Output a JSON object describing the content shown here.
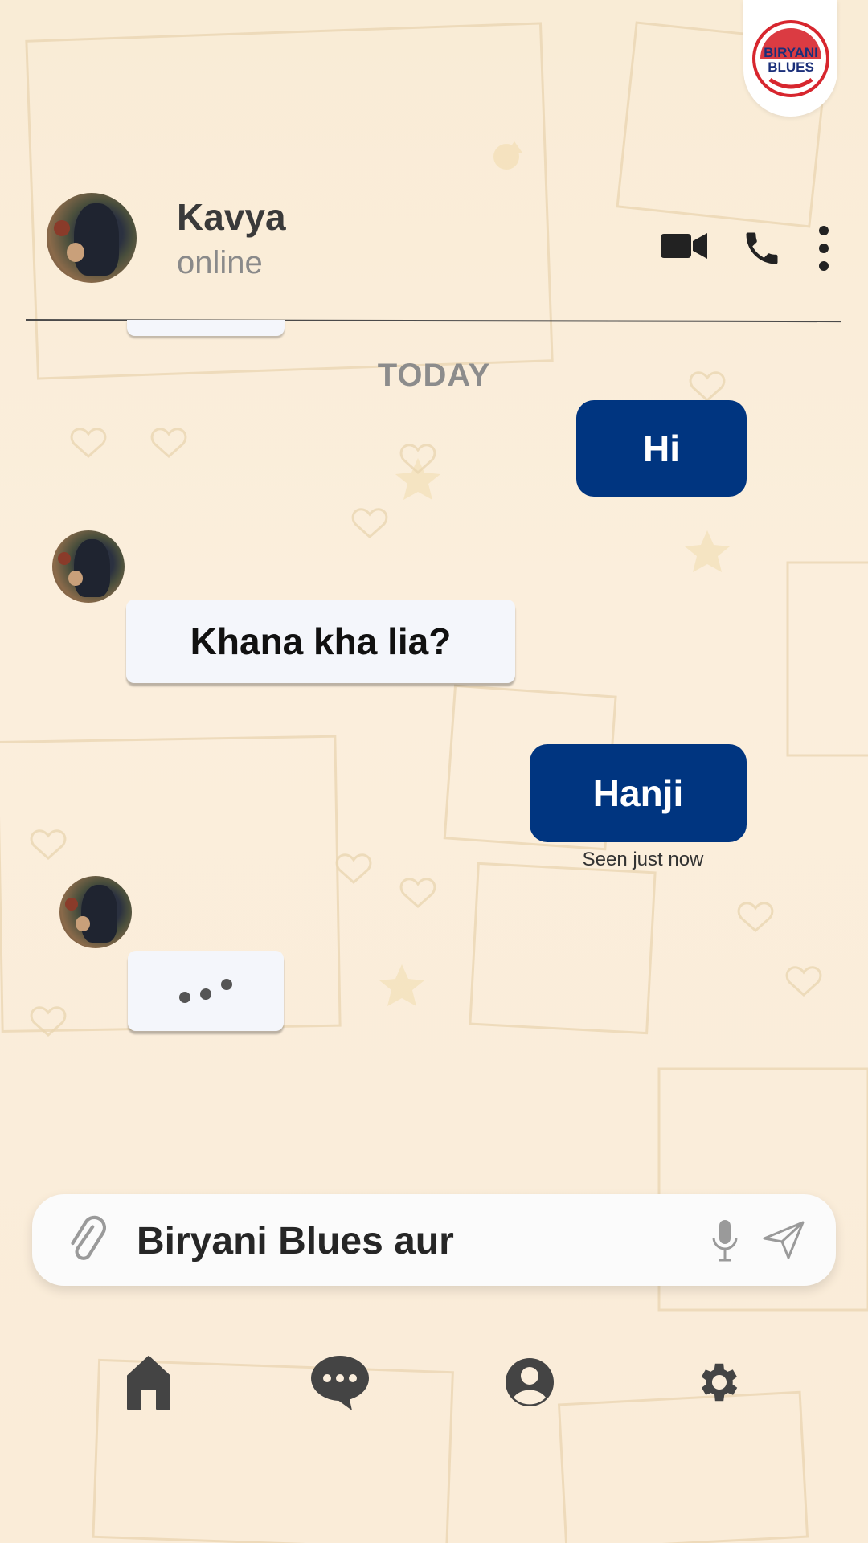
{
  "brand": {
    "logo_text": "BIRYANI BLUES",
    "colors": {
      "navy": "#003580",
      "red": "#d7262e"
    }
  },
  "header": {
    "contact_name": "Kavya",
    "contact_status": "online",
    "icons": [
      "video-call-icon",
      "phone-icon",
      "more-vertical-icon"
    ]
  },
  "chat": {
    "day_label": "TODAY",
    "messages": [
      {
        "direction": "outgoing",
        "text": "Hi"
      },
      {
        "direction": "incoming",
        "text": "Khana kha lia?"
      },
      {
        "direction": "outgoing",
        "text": "Hanji",
        "receipt": "Seen just now"
      },
      {
        "direction": "incoming",
        "typing": true
      }
    ]
  },
  "composer": {
    "value": "Biryani Blues aur",
    "icons": [
      "attachment-icon",
      "microphone-icon",
      "send-icon"
    ]
  },
  "bottom_nav": {
    "items": [
      {
        "name": "home",
        "icon": "home-icon",
        "active": true
      },
      {
        "name": "chats",
        "icon": "chat-bubble-icon"
      },
      {
        "name": "profile",
        "icon": "user-icon"
      },
      {
        "name": "settings",
        "icon": "settings-gear-icon"
      }
    ]
  }
}
